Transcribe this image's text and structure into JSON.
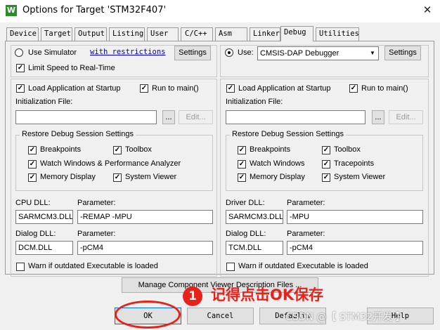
{
  "window": {
    "title": "Options for Target 'STM32F407'",
    "app_icon_glyph": "W",
    "close_glyph": "✕"
  },
  "tabs": [
    "Device",
    "Target",
    "Output",
    "Listing",
    "User",
    "C/C++",
    "Asm",
    "Linker",
    "Debug",
    "Utilities"
  ],
  "active_tab": "Debug",
  "left": {
    "use_simulator_label": "Use Simulator",
    "restrictions_link": "with restrictions",
    "settings_button": "Settings",
    "limit_speed_label": "Limit Speed to Real-Time",
    "load_app_label": "Load Application at Startup",
    "run_to_main_label": "Run to main()",
    "init_file_label": "Initialization File:",
    "init_file_value": "",
    "browse_button": "...",
    "edit_button": "Edit...",
    "restore_group_title": "Restore Debug Session Settings",
    "restore_items": [
      "Breakpoints",
      "Toolbox",
      "Watch Windows & Performance Analyzer",
      "Memory Display",
      "System Viewer"
    ],
    "cpu_dll_label": "CPU DLL:",
    "cpu_param_label": "Parameter:",
    "cpu_dll_value": "SARMCM3.DLL",
    "cpu_param_value": "-REMAP -MPU",
    "dialog_dll_label": "Dialog DLL:",
    "dialog_param_label": "Parameter:",
    "dialog_dll_value": "DCM.DLL",
    "dialog_param_value": "-pCM4",
    "warn_label": "Warn if outdated Executable is loaded"
  },
  "right": {
    "use_label": "Use:",
    "debugger_value": "CMSIS-DAP Debugger",
    "settings_button": "Settings",
    "load_app_label": "Load Application at Startup",
    "run_to_main_label": "Run to main()",
    "init_file_label": "Initialization File:",
    "init_file_value": "",
    "browse_button": "...",
    "edit_button": "Edit...",
    "restore_group_title": "Restore Debug Session Settings",
    "restore_items": [
      "Breakpoints",
      "Toolbox",
      "Watch Windows",
      "Tracepoints",
      "Memory Display",
      "System Viewer"
    ],
    "driver_dll_label": "Driver DLL:",
    "driver_param_label": "Parameter:",
    "driver_dll_value": "SARMCM3.DLL",
    "driver_param_value": "-MPU",
    "dialog_dll_label": "Dialog DLL:",
    "dialog_param_label": "Parameter:",
    "dialog_dll_value": "TCM.DLL",
    "dialog_param_value": "-pCM4",
    "warn_label": "Warn if outdated Executable is loaded"
  },
  "manage_button": "Manage Component Viewer Description Files ...",
  "buttons": {
    "ok": "OK",
    "cancel": "Cancel",
    "defaults": "Defaults",
    "help": "Help"
  },
  "annotation": {
    "number": "1",
    "text": "记得点击OK保存",
    "color": "#e8221b"
  },
  "watermark": "CSDN @【 STM32开发 】",
  "checkbox_glyph": "✓"
}
